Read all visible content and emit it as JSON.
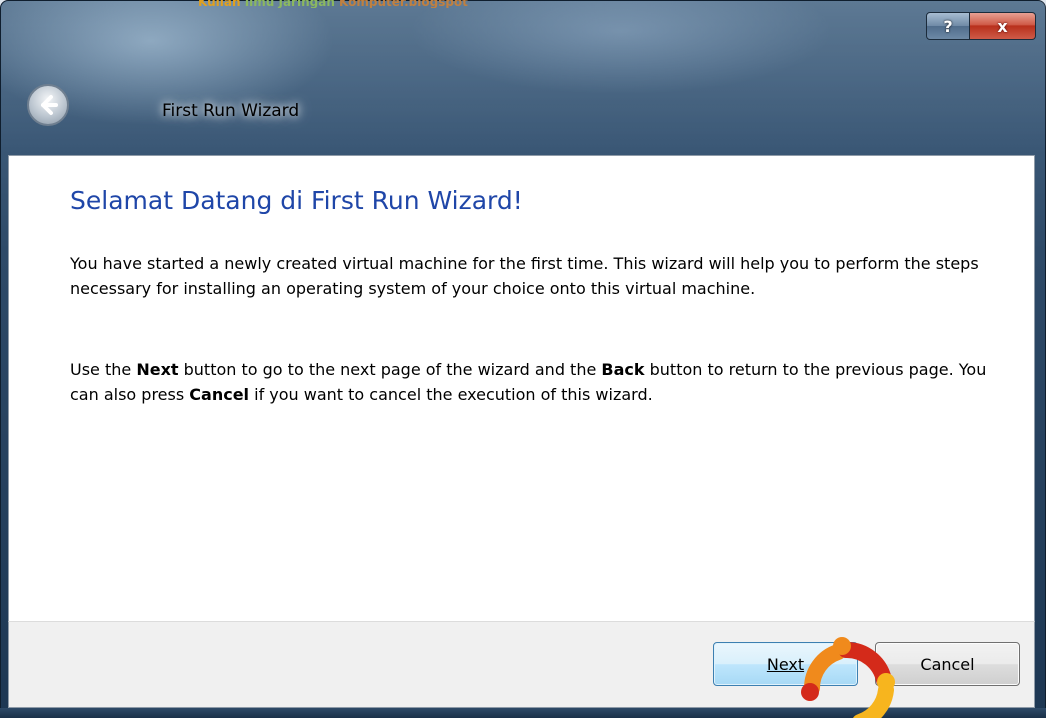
{
  "watermark": {
    "part1": "Kuliah ",
    "part2": "Ilmu Jaringan ",
    "part3": "Komputer.blogspot"
  },
  "titlebar": {
    "title": "First Run Wizard",
    "help_label": "?",
    "close_label": "x"
  },
  "content": {
    "heading": "Selamat Datang di First Run Wizard!",
    "paragraph1": "You have started a newly created virtual machine for the first time. This wizard will help you to perform the steps necessary for installing an operating system of your choice onto this virtual machine.",
    "paragraph2": {
      "t1": "Use the ",
      "b1": "Next",
      "t2": " button to go to the next page of the wizard and the ",
      "b2": "Back",
      "t3": " button to return to the previous page. You can also press ",
      "b3": "Cancel",
      "t4": " if you want to cancel the execution of this wizard."
    }
  },
  "footer": {
    "next_label": "Next",
    "cancel_label": "Cancel"
  },
  "colors": {
    "heading": "#1f46a8",
    "titlebar": "#2e4a68",
    "close_button": "#c7402c",
    "logo_orange": "#f08a1c",
    "logo_red": "#d42a1a",
    "logo_yellow": "#f7b51e"
  },
  "icons": {
    "back": "back-arrow-icon",
    "logo": "ubuntu-logo-icon"
  }
}
